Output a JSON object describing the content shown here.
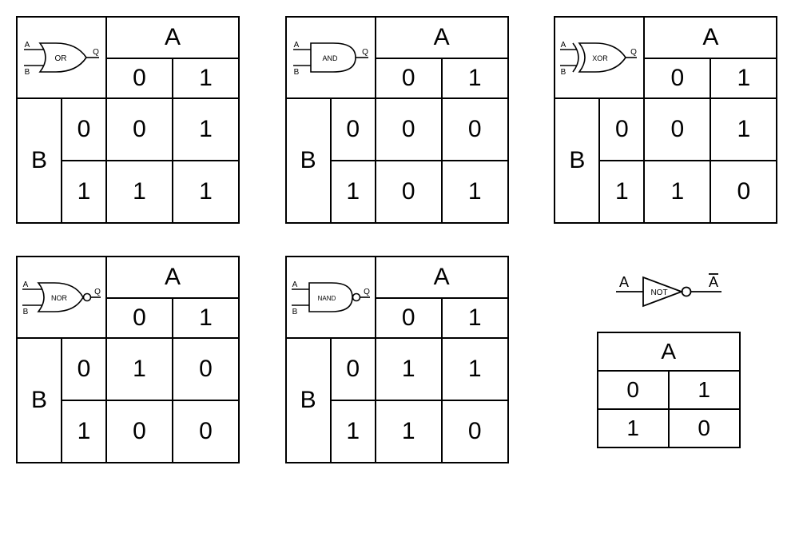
{
  "labels": {
    "A": "A",
    "B": "B",
    "zero": "0",
    "one": "1",
    "Abar": "A̅"
  },
  "gates": {
    "or": {
      "name": "OR",
      "table": [
        [
          0,
          1
        ],
        [
          1,
          1
        ]
      ]
    },
    "and": {
      "name": "AND",
      "table": [
        [
          0,
          0
        ],
        [
          0,
          1
        ]
      ]
    },
    "xor": {
      "name": "XOR",
      "table": [
        [
          0,
          1
        ],
        [
          1,
          0
        ]
      ]
    },
    "nor": {
      "name": "NOR",
      "table": [
        [
          1,
          0
        ],
        [
          0,
          0
        ]
      ]
    },
    "nand": {
      "name": "NAND",
      "table": [
        [
          1,
          1
        ],
        [
          1,
          0
        ]
      ]
    },
    "not": {
      "name": "NOT",
      "table": [
        0,
        1,
        1,
        0
      ]
    }
  },
  "chart_data": [
    {
      "type": "table",
      "title": "OR truth table",
      "columns": [
        "B",
        "A=0",
        "A=1"
      ],
      "rows": [
        [
          "0",
          0,
          1
        ],
        [
          "1",
          1,
          1
        ]
      ]
    },
    {
      "type": "table",
      "title": "AND truth table",
      "columns": [
        "B",
        "A=0",
        "A=1"
      ],
      "rows": [
        [
          "0",
          0,
          0
        ],
        [
          "1",
          0,
          1
        ]
      ]
    },
    {
      "type": "table",
      "title": "XOR truth table",
      "columns": [
        "B",
        "A=0",
        "A=1"
      ],
      "rows": [
        [
          "0",
          0,
          1
        ],
        [
          "1",
          1,
          0
        ]
      ]
    },
    {
      "type": "table",
      "title": "NOR truth table",
      "columns": [
        "B",
        "A=0",
        "A=1"
      ],
      "rows": [
        [
          "0",
          1,
          0
        ],
        [
          "1",
          0,
          0
        ]
      ]
    },
    {
      "type": "table",
      "title": "NAND truth table",
      "columns": [
        "B",
        "A=0",
        "A=1"
      ],
      "rows": [
        [
          "0",
          1,
          1
        ],
        [
          "1",
          1,
          0
        ]
      ]
    },
    {
      "type": "table",
      "title": "NOT truth table",
      "columns": [
        "A"
      ],
      "rows": [
        [
          0
        ],
        [
          1
        ],
        [
          1
        ],
        [
          0
        ]
      ]
    }
  ]
}
